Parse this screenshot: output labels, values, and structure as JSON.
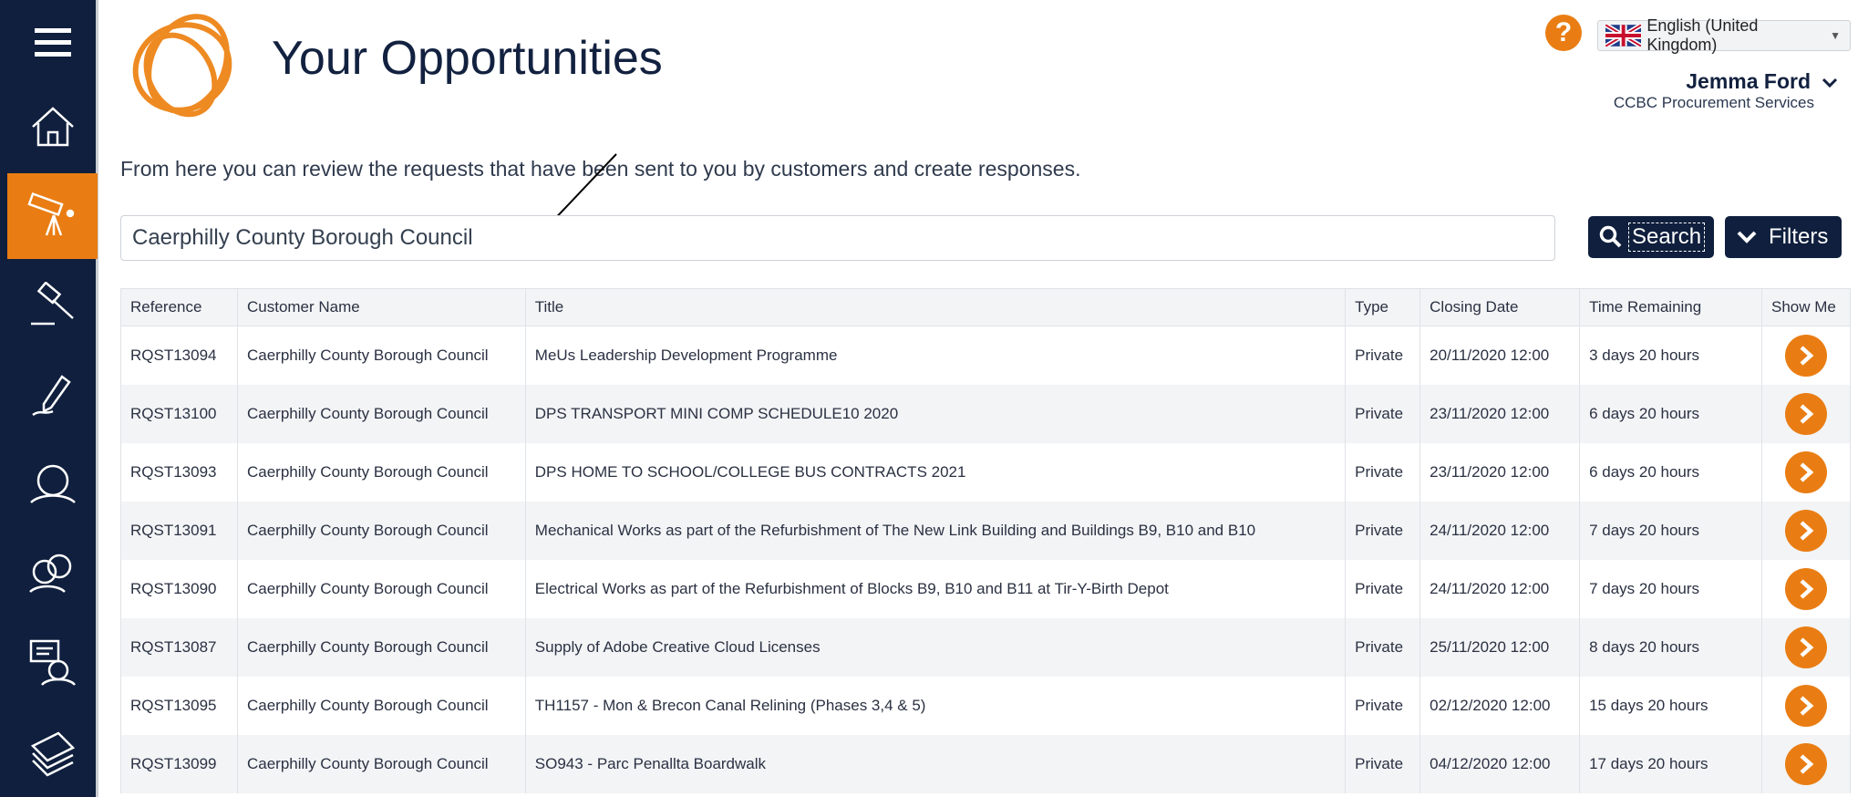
{
  "header": {
    "title": "Your Opportunities",
    "help_glyph": "?",
    "language": "English (United Kingdom)",
    "user_name": "Jemma Ford",
    "user_org": "CCBC Procurement Services"
  },
  "sidebar": {
    "items": [
      {
        "icon": "menu-icon"
      },
      {
        "icon": "home-icon"
      },
      {
        "icon": "telescope-icon",
        "active": true
      },
      {
        "icon": "gavel-icon"
      },
      {
        "icon": "pen-icon"
      },
      {
        "icon": "person-icon"
      },
      {
        "icon": "people-icon"
      },
      {
        "icon": "chat-person-icon"
      },
      {
        "icon": "document-stack-icon"
      }
    ]
  },
  "intro_text": "From here you can review the requests that have been sent to you by customers and create responses.",
  "search": {
    "value": "Caerphilly County Borough Council",
    "search_label": "Search",
    "filters_label": "Filters"
  },
  "table": {
    "columns": [
      "Reference",
      "Customer Name",
      "Title",
      "Type",
      "Closing Date",
      "Time Remaining",
      "Show Me"
    ],
    "rows": [
      {
        "reference": "RQST13094",
        "customer": "Caerphilly County Borough Council",
        "title": "MeUs Leadership Development Programme",
        "type": "Private",
        "closing": "20/11/2020 12:00",
        "remaining": "3 days 20 hours"
      },
      {
        "reference": "RQST13100",
        "customer": "Caerphilly County Borough Council",
        "title": "DPS TRANSPORT MINI COMP SCHEDULE10 2020",
        "type": "Private",
        "closing": "23/11/2020 12:00",
        "remaining": "6 days 20 hours"
      },
      {
        "reference": "RQST13093",
        "customer": "Caerphilly County Borough Council",
        "title": "DPS HOME TO SCHOOL/COLLEGE BUS CONTRACTS 2021",
        "type": "Private",
        "closing": "23/11/2020 12:00",
        "remaining": "6 days 20 hours"
      },
      {
        "reference": "RQST13091",
        "customer": "Caerphilly County Borough Council",
        "title": "Mechanical Works as part of the Refurbishment of The New Link Building and Buildings B9, B10 and B10",
        "type": "Private",
        "closing": "24/11/2020 12:00",
        "remaining": "7 days 20 hours"
      },
      {
        "reference": "RQST13090",
        "customer": "Caerphilly County Borough Council",
        "title": "Electrical Works as part of the Refurbishment of Blocks B9, B10 and B11 at Tir-Y-Birth Depot",
        "type": "Private",
        "closing": "24/11/2020 12:00",
        "remaining": "7 days 20 hours"
      },
      {
        "reference": "RQST13087",
        "customer": "Caerphilly County Borough Council",
        "title": "Supply of Adobe Creative Cloud Licenses",
        "type": "Private",
        "closing": "25/11/2020 12:00",
        "remaining": "8 days 20 hours"
      },
      {
        "reference": "RQST13095",
        "customer": "Caerphilly County Borough Council",
        "title": "TH1157 - Mon & Brecon Canal Relining (Phases 3,4 & 5)",
        "type": "Private",
        "closing": "02/12/2020 12:00",
        "remaining": "15 days 20 hours"
      },
      {
        "reference": "RQST13099",
        "customer": "Caerphilly County Borough Council",
        "title": "SO943 - Parc Penallta Boardwalk",
        "type": "Private",
        "closing": "04/12/2020 12:00",
        "remaining": "17 days 20 hours"
      }
    ]
  },
  "colors": {
    "navy": "#0f1f3d",
    "orange": "#e97d13",
    "row_alt": "#f3f4f6"
  }
}
